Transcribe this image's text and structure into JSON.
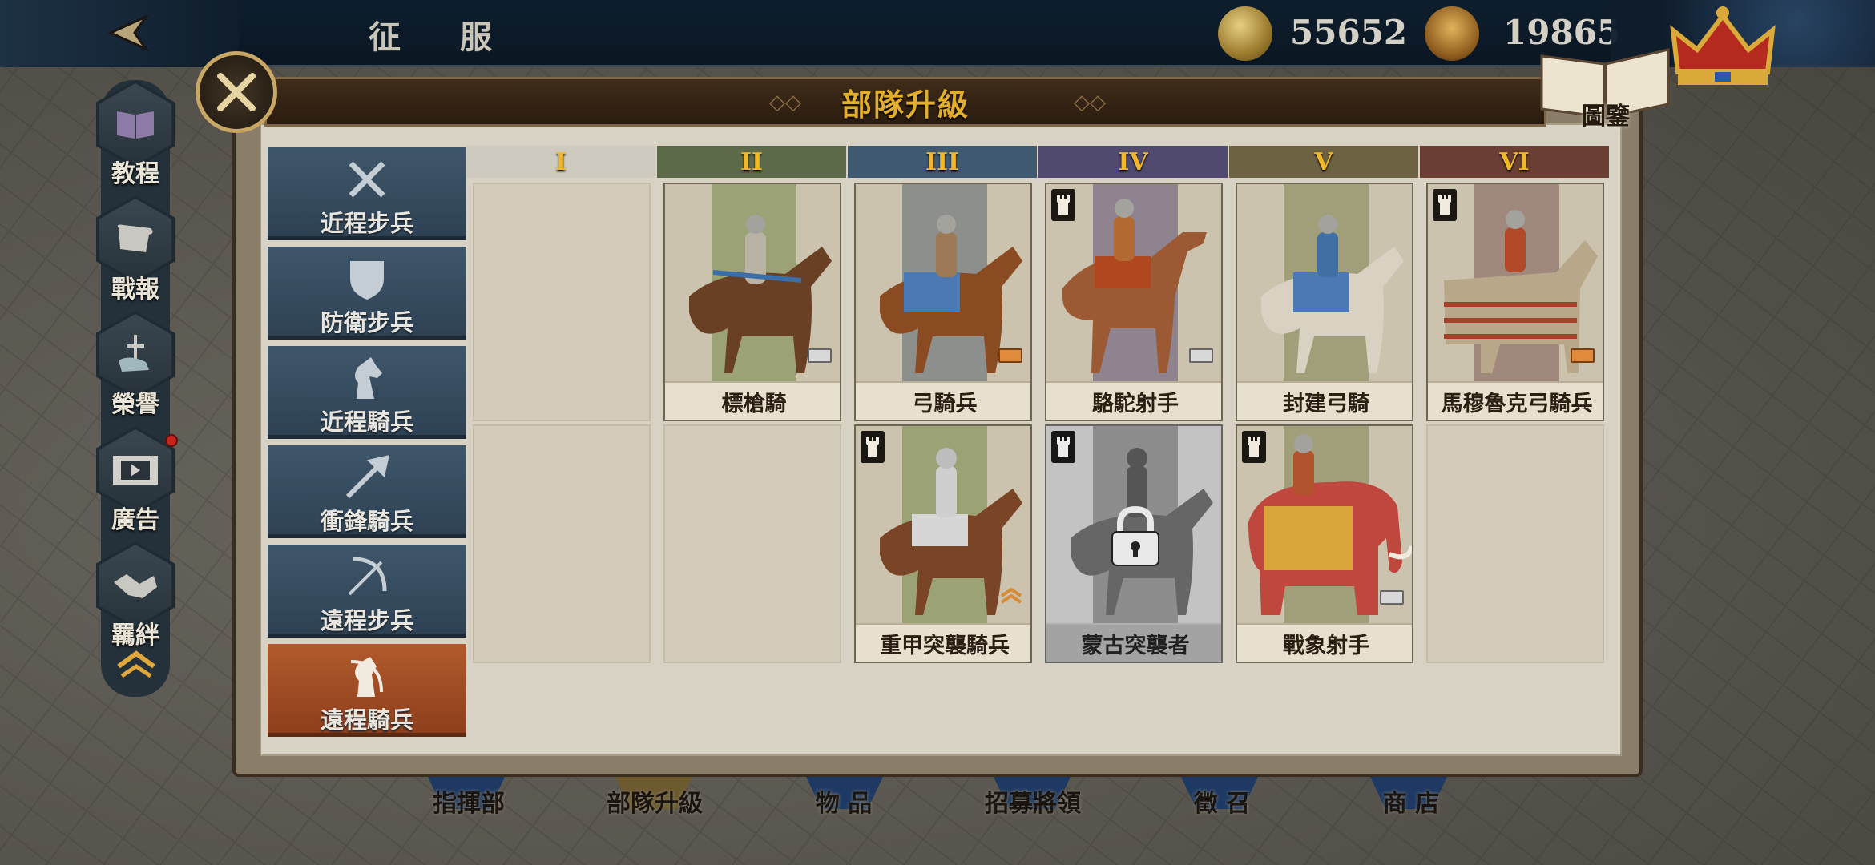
{
  "header": {
    "title": "征 服",
    "gold_amount": "55652",
    "crown_amount": "19865",
    "codex_label": "圖鑒"
  },
  "sidebar": {
    "items": [
      {
        "label": "教程",
        "icon": "book-icon"
      },
      {
        "label": "戰報",
        "icon": "scroll-icon"
      },
      {
        "label": "榮譽",
        "icon": "sword-hand-icon"
      },
      {
        "label": "廣告",
        "icon": "film-icon"
      },
      {
        "label": "羈絆",
        "icon": "handshake-icon"
      }
    ]
  },
  "panel": {
    "title": "部隊升級"
  },
  "categories": [
    {
      "label": "近程步兵",
      "icon": "crossed-swords-icon",
      "active": false
    },
    {
      "label": "防衛步兵",
      "icon": "shield-icon",
      "active": false
    },
    {
      "label": "近程騎兵",
      "icon": "knight-horse-icon",
      "active": false
    },
    {
      "label": "衝鋒騎兵",
      "icon": "lance-icon",
      "active": false
    },
    {
      "label": "遠程步兵",
      "icon": "bow-icon",
      "active": false
    },
    {
      "label": "遠程騎兵",
      "icon": "horse-archer-icon",
      "active": true
    }
  ],
  "tiers": [
    "I",
    "II",
    "III",
    "IV",
    "V",
    "VI"
  ],
  "units": {
    "row1": [
      {
        "name": "標槍騎"
      },
      {
        "name": "弓騎兵"
      },
      {
        "name": "駱駝射手"
      },
      {
        "name": "封建弓騎"
      },
      {
        "name": "馬穆魯克弓騎兵"
      }
    ],
    "row2": [
      {
        "name": "重甲突襲騎兵"
      },
      {
        "name": "蒙古突襲者",
        "locked": true
      },
      {
        "name": "戰象射手"
      }
    ]
  },
  "bottom_nav": [
    "指揮部",
    "部隊升級",
    "物 品",
    "招募將領",
    "徵 召",
    "商 店"
  ],
  "colors": {
    "accent": "#e3ae2c",
    "active_tab": "#b25a2d",
    "inactive_tab": "#3f566a"
  }
}
